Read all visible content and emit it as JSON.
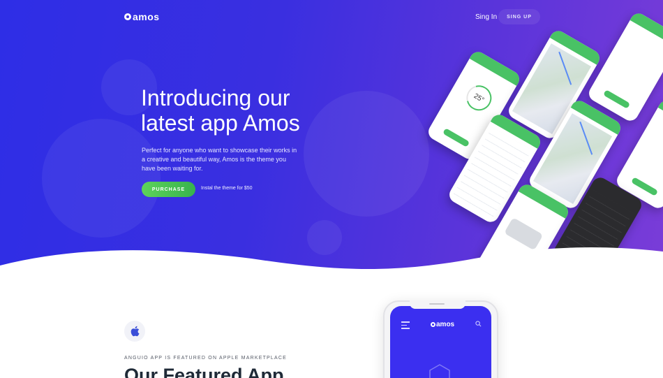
{
  "header": {
    "logo_text": "amos",
    "signin_label": "Sing In",
    "signup_label": "SING UP"
  },
  "hero": {
    "title": "Introducing our latest app Amos",
    "description": "Perfect for anyone who want to showcase their works in a creative and beautiful way, Amos is the theme you have been waiting for.",
    "purchase_label": "PURCHASE",
    "install_note": "Instal the theme for $50",
    "gauge_value": "25°"
  },
  "featured": {
    "eyebrow": "ANGUIO APP IS FEATURED ON APPLE MARKETPLACE",
    "title": "Our Featured App",
    "phone_logo_text": "amos"
  },
  "colors": {
    "hero_start": "#2e2ee6",
    "hero_end": "#7a3cd8",
    "accent_green": "#49c265",
    "heading_dark": "#1f2a37"
  },
  "icons": [
    "logo-mark-icon",
    "apple-icon",
    "menu-icon",
    "search-icon"
  ]
}
